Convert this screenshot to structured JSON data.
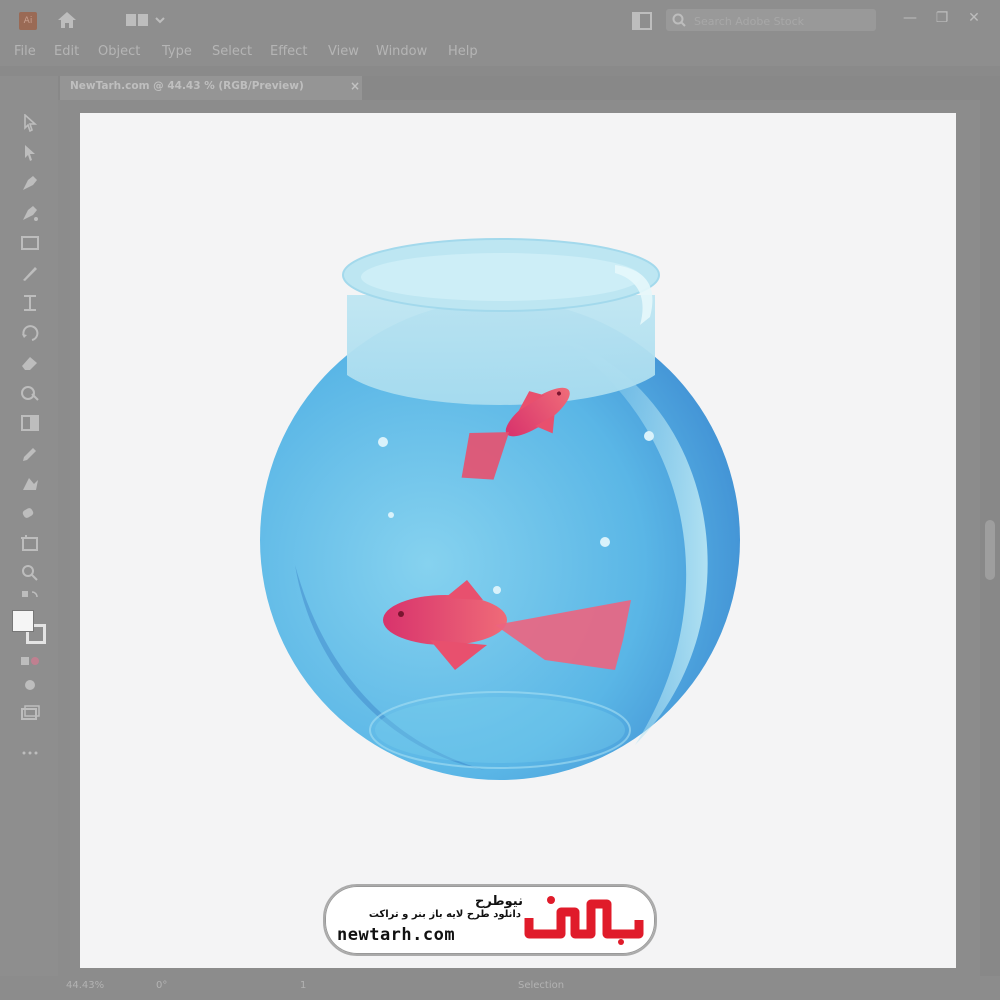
{
  "app": {
    "logo_text": "Ai",
    "search_placeholder": "Search Adobe Stock",
    "colors": {
      "chrome": "#8e8e8e",
      "artboard": "#f4f4f5",
      "water": "#5fb7e8",
      "fish": "#e8506e",
      "watermark_red": "#e01b2a"
    }
  },
  "menu": [
    "File",
    "Edit",
    "Object",
    "Type",
    "Select",
    "Effect",
    "View",
    "Window",
    "Help"
  ],
  "document": {
    "tab_title": "NewTarh.com @ 44.43 % (RGB/Preview)",
    "close_glyph": "×"
  },
  "window_controls": {
    "minimize": "—",
    "restore": "❐",
    "close": "✕"
  },
  "status": {
    "zoom": "44.43%",
    "rotation": "0°",
    "artboard_no": "1",
    "tool": "Selection"
  },
  "watermark": {
    "title": "نیوطرح",
    "subtitle": "دانلود طرح لایه باز بنر و تراکت",
    "url": "newtarh.com",
    "logo_word": "نیوطرح"
  },
  "tools": [
    "selection-tool",
    "direct-selection-tool",
    "pen-tool",
    "curvature-tool",
    "rectangle-tool",
    "paintbrush-tool",
    "width-tool",
    "rotate-tool",
    "eraser-tool",
    "shape-builder-tool",
    "gradient-tool",
    "eyedropper-tool",
    "symbol-sprayer-tool",
    "blend-tool",
    "artboard-tool",
    "zoom-tool"
  ],
  "artwork": {
    "description_label": ""
  }
}
